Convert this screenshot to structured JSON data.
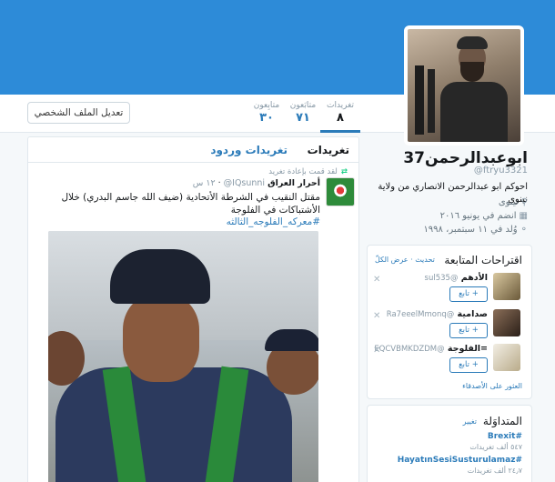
{
  "profile": {
    "name": "ابوعبدالرحمن37",
    "handle": "@ftryu3321",
    "bio": "احوكم ابو عبدالرحمن الانصاري من ولاية نينوى",
    "location": "نينوى",
    "joined": "انضم في يونيو ٢٠١٦",
    "born": "وُلد في ١١ سبتمبر، ١٩٩٨"
  },
  "nav": {
    "edit_profile": "تعديل الملف الشخصي",
    "stats": [
      {
        "label": "تغريدات",
        "value": "٨"
      },
      {
        "label": "متابَعون",
        "value": "٧١"
      },
      {
        "label": "متابِعون",
        "value": "٣٠"
      }
    ]
  },
  "timeline": {
    "tabs": [
      "تغريدات",
      "تغريدات وردود"
    ],
    "retweet_note": "لقد قمت بإعادة تغريد",
    "tweet": {
      "author": "أحرار العراق",
      "handle": "@IQsunni",
      "time": "١٢ س",
      "text": "مقتل النقيب في الشرطة الأتحادية (ضيف الله جاسم البدري) خلال الأشتباكات في الفلوجة",
      "hashtag": "#معركه_الفلوجه_الثالثه"
    }
  },
  "who_to_follow": {
    "title": "اقتراحات المتابعة",
    "refresh": "تحديث",
    "view_all": "عرض الكلّ",
    "follow_label": "تابع",
    "find_friends": "العثور على الأصدقاء",
    "items": [
      {
        "name": "الأدهم",
        "handle": "@sul535"
      },
      {
        "name": "صدامية",
        "handle": "@Ra7eeelMmonq"
      },
      {
        "name": "=الفلوجة",
        "handle": "@EQCVBMKDZDM"
      }
    ]
  },
  "trends": {
    "title": "المتداوَلة",
    "change": "تغيير",
    "items": [
      {
        "tag": "#Brexit",
        "count": "٥٤٧ ألف تغريدات"
      },
      {
        "tag": "#HayatınSesiSusturulamaz",
        "count": "٢٤٫٧ ألف تغريدات"
      }
    ]
  },
  "colors": {
    "banner": "#2d8bd8",
    "link": "#2b7bb9"
  }
}
